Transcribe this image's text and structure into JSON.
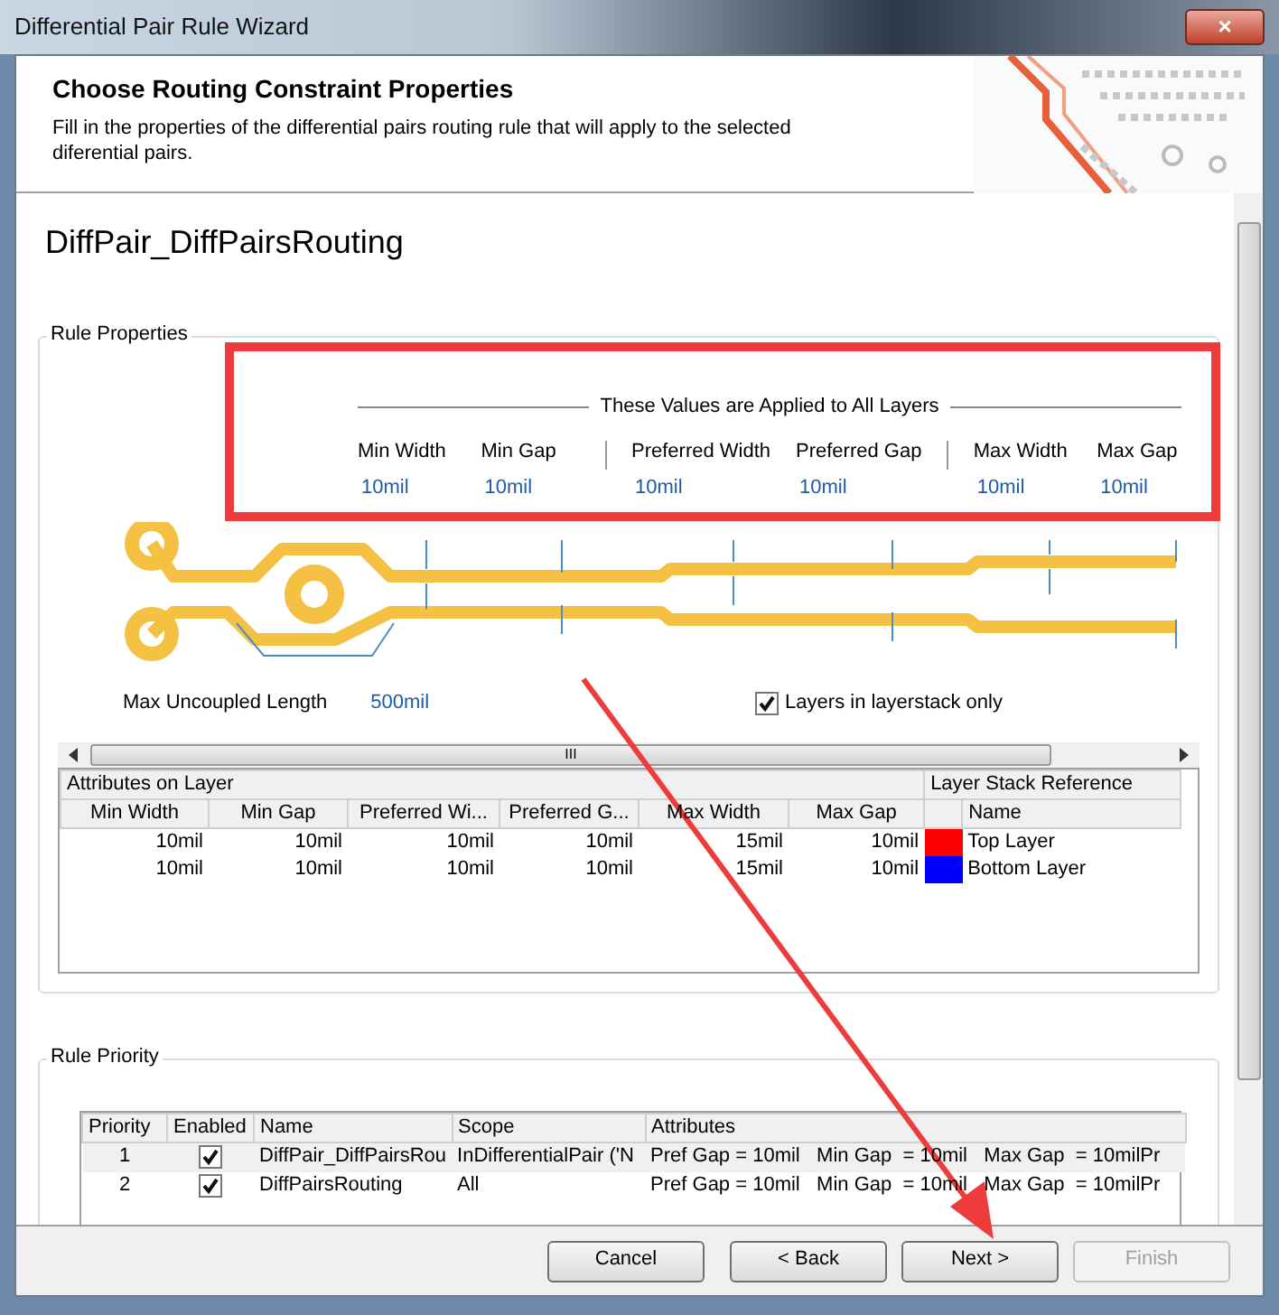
{
  "window": {
    "title": "Differential Pair Rule Wizard",
    "close": "×"
  },
  "header": {
    "title": "Choose Routing Constraint Properties",
    "description": "Fill in the properties of the differential pairs routing rule that will apply to the selected diferential pairs."
  },
  "rule_name": "DiffPair_DiffPairsRouting",
  "rule_properties": {
    "title": "Rule Properties",
    "banner": "These Values are Applied to All Layers",
    "values": [
      {
        "label": "Min Width",
        "value": "10mil"
      },
      {
        "label": "Min Gap",
        "value": "10mil"
      },
      {
        "label": "Preferred Width",
        "value": "10mil"
      },
      {
        "label": "Preferred Gap",
        "value": "10mil"
      },
      {
        "label": "Max Width",
        "value": "10mil"
      },
      {
        "label": "Max Gap",
        "value": "10mil"
      }
    ],
    "uncoupled_label": "Max Uncoupled Length",
    "uncoupled_value": "500mil",
    "layers_only": {
      "label": "Layers in layerstack only",
      "checked": true
    },
    "scroll_grip": "III",
    "layer_table": {
      "group_left": "Attributes on Layer",
      "group_right": "Layer Stack Reference",
      "columns": [
        "Min Width",
        "Min Gap",
        "Preferred Wi...",
        "Preferred G...",
        "Max Width",
        "Max Gap",
        "Name"
      ],
      "rows": [
        {
          "cells": [
            "10mil",
            "10mil",
            "10mil",
            "10mil",
            "15mil",
            "10mil"
          ],
          "color": "#ff0000",
          "name": "Top Layer"
        },
        {
          "cells": [
            "10mil",
            "10mil",
            "10mil",
            "10mil",
            "15mil",
            "10mil"
          ],
          "color": "#0000ff",
          "name": "Bottom Layer"
        }
      ]
    }
  },
  "rule_priority": {
    "title": "Rule Priority",
    "columns": [
      "Priority",
      "Enabled",
      "Name",
      "Scope",
      "Attributes"
    ],
    "rows": [
      {
        "selected": true,
        "priority": "1",
        "enabled": true,
        "name": "DiffPair_DiffPairsRou",
        "scope": "InDifferentialPair ('N",
        "attributes": "Pref Gap = 10mil   Min Gap  = 10mil   Max Gap  = 10milPr"
      },
      {
        "selected": false,
        "priority": "2",
        "enabled": true,
        "name": "DiffPairsRouting",
        "scope": "All",
        "attributes": "Pref Gap = 10mil   Min Gap  = 10mil   Max Gap  = 10milPr"
      }
    ]
  },
  "buttons": [
    {
      "label": "Cancel",
      "disabled": false
    },
    {
      "label": "< Back",
      "disabled": false
    },
    {
      "label": "Next >",
      "disabled": false
    },
    {
      "label": "Finish",
      "disabled": true
    }
  ]
}
